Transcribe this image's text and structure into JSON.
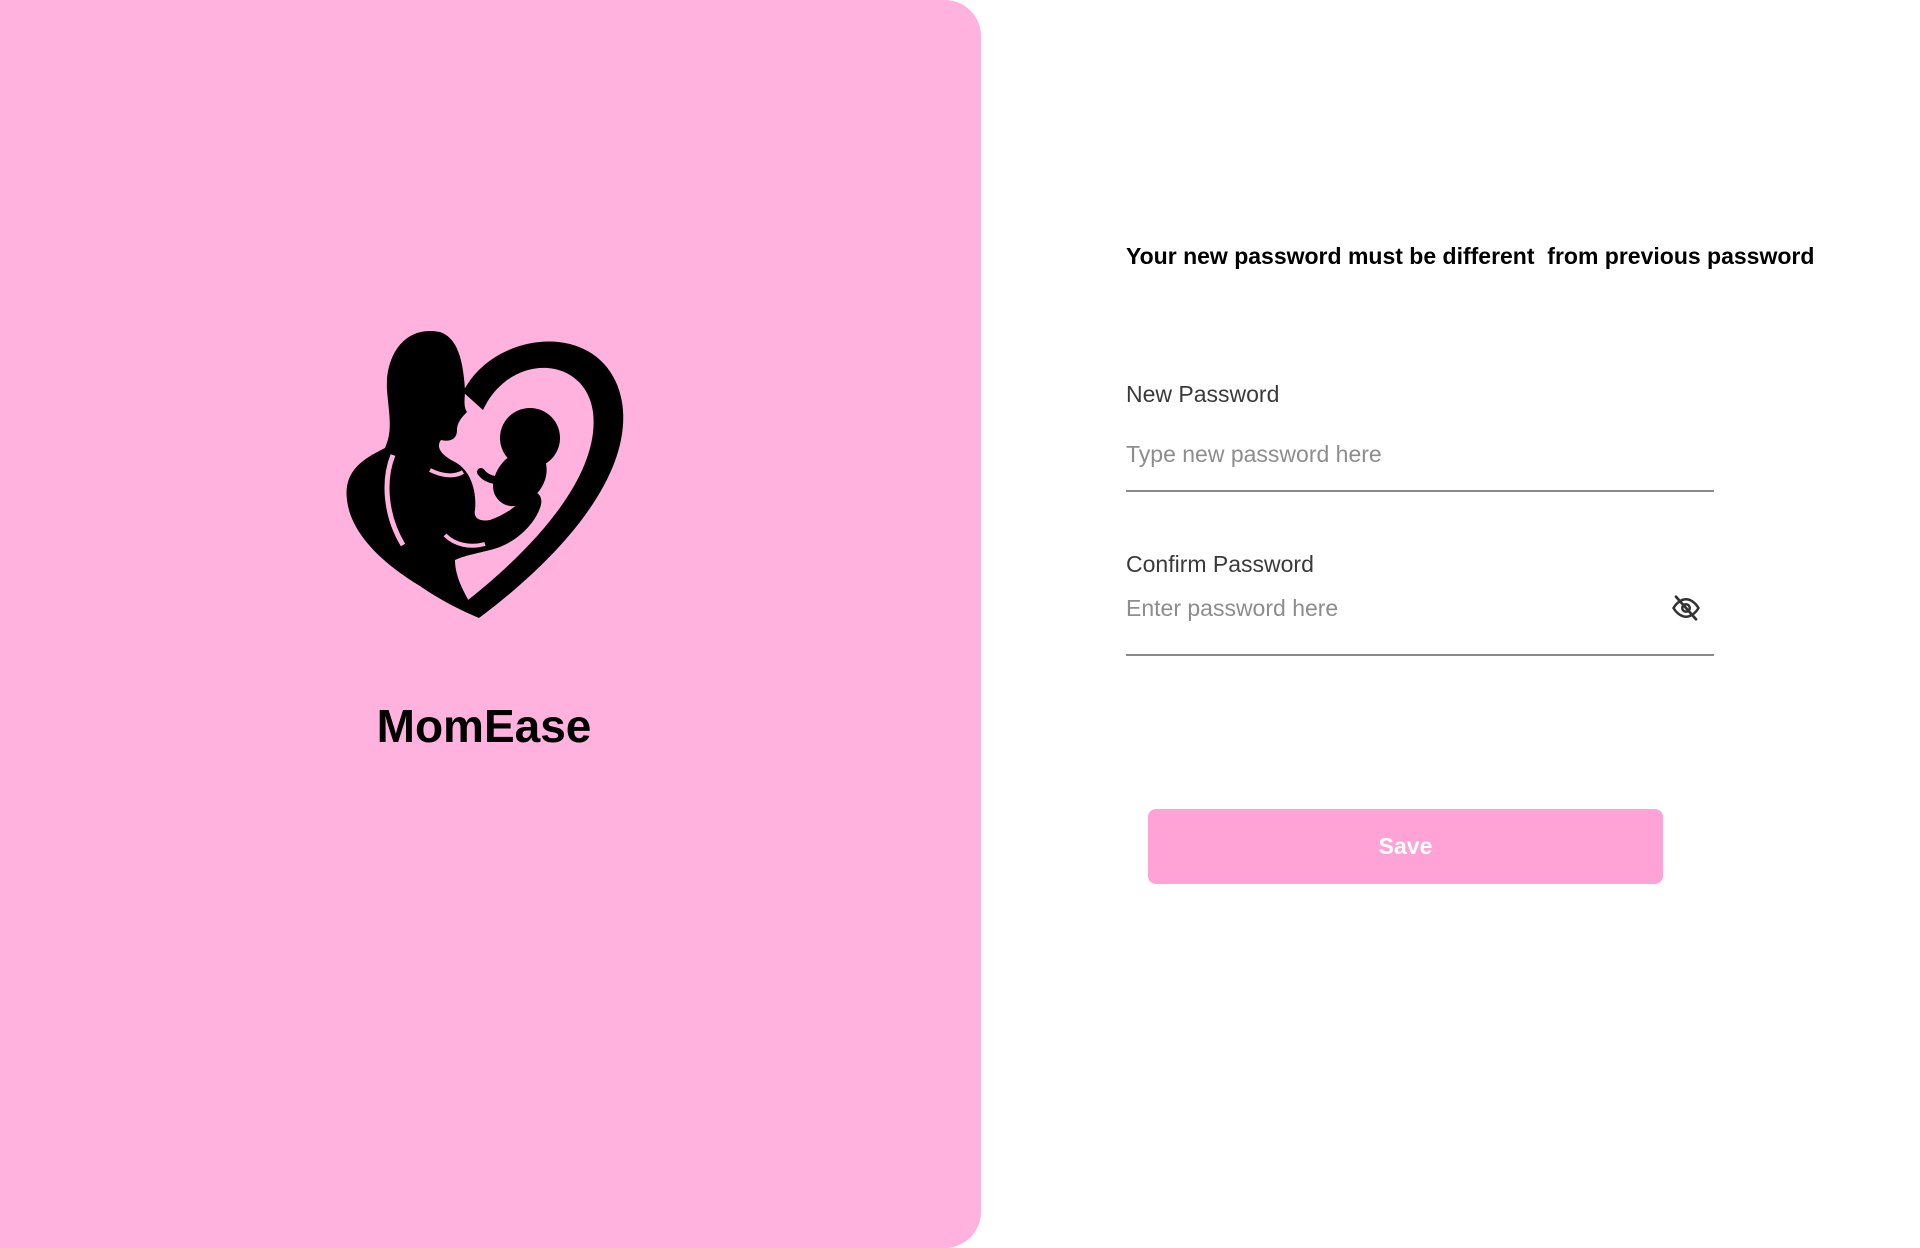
{
  "brand": {
    "name": "MomEase",
    "logo_icon": "mother-baby-heart-icon",
    "panel_color": "#FFB2DD"
  },
  "form": {
    "subtitle": "Your new password must be different  from previous password",
    "new_password": {
      "label": "New Password",
      "placeholder": "Type new password here"
    },
    "confirm_password": {
      "label": "Confirm Password",
      "placeholder": "Enter password here",
      "toggle_icon": "eye-off-icon"
    },
    "save_button": {
      "label": "Save",
      "color": "#FFA3D6"
    }
  }
}
